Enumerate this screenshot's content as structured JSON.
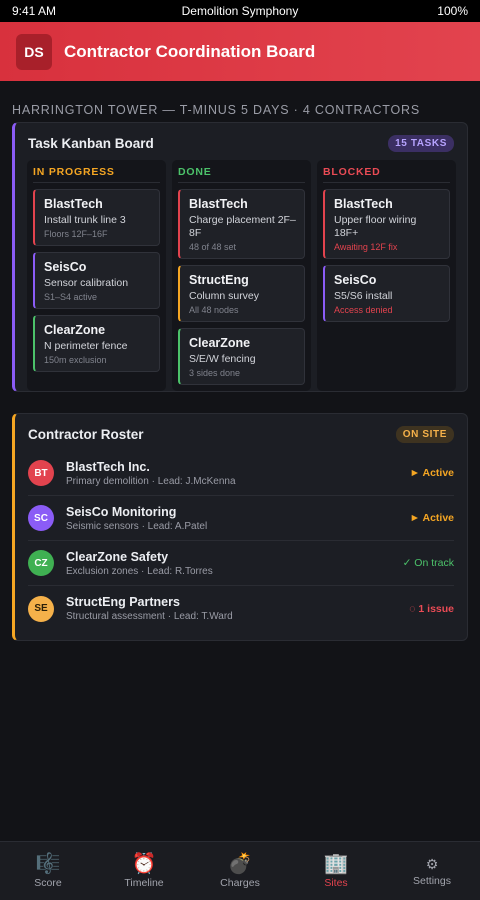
{
  "status_bar": {
    "time": "9:41 AM",
    "title": "Demolition Symphony",
    "battery": "100%"
  },
  "header": {
    "logo": "DS",
    "title": "Contractor Coordination Board"
  },
  "meta": "HARRINGTON TOWER — T-MINUS 5 DAYS · 4 CONTRACTORS",
  "kanban": {
    "title": "Task Kanban Board",
    "badge": "15 TASKS",
    "columns": [
      {
        "label": "IN PROGRESS",
        "tasks": [
          {
            "title": "BlastTech",
            "desc": "Install trunk line 3",
            "note": "Floors 12F–16F"
          },
          {
            "title": "SeisCo",
            "desc": "Sensor calibration",
            "note": "S1–S4 active"
          },
          {
            "title": "ClearZone",
            "desc": "N perimeter fence",
            "note": "150m exclusion"
          }
        ]
      },
      {
        "label": "DONE",
        "tasks": [
          {
            "title": "BlastTech",
            "desc": "Charge placement 2F–8F",
            "note": "48 of 48 set"
          },
          {
            "title": "StructEng",
            "desc": "Column survey",
            "note": "All 48 nodes"
          },
          {
            "title": "ClearZone",
            "desc": "S/E/W fencing",
            "note": "3 sides done"
          }
        ]
      },
      {
        "label": "BLOCKED",
        "tasks": [
          {
            "title": "BlastTech",
            "desc": "Upper floor wiring 18F+",
            "note": "Awaiting 12F fix"
          },
          {
            "title": "SeisCo",
            "desc": "S5/S6 install",
            "note": "Access denied"
          }
        ]
      }
    ]
  },
  "roster": {
    "title": "Contractor Roster",
    "badge": "ON SITE",
    "rows": [
      {
        "initials": "BT",
        "name": "BlastTech Inc.",
        "sub": "Primary demolition · Lead: J.McKenna",
        "status": "► Active"
      },
      {
        "initials": "SC",
        "name": "SeisCo Monitoring",
        "sub": "Seismic sensors · Lead: A.Patel",
        "status": "► Active"
      },
      {
        "initials": "CZ",
        "name": "ClearZone Safety",
        "sub": "Exclusion zones · Lead: R.Torres",
        "status": "✓ On track"
      },
      {
        "initials": "SE",
        "name": "StructEng Partners",
        "sub": "Structural assessment · Lead: T.Ward",
        "status": "◌ 1 issue"
      }
    ]
  },
  "tabs": [
    {
      "label": "Score",
      "icon": "🎼"
    },
    {
      "label": "Timeline",
      "icon": "⏰"
    },
    {
      "label": "Charges",
      "icon": "💣"
    },
    {
      "label": "Sites",
      "icon": "🏢"
    },
    {
      "label": "Settings",
      "icon": "⚙"
    }
  ],
  "colors": {
    "accent": "#e2434e",
    "in_progress": "#f5a623",
    "done": "#4cc26a",
    "blocked": "#ea4b55",
    "kanban_accent": "#8b5cf6"
  }
}
